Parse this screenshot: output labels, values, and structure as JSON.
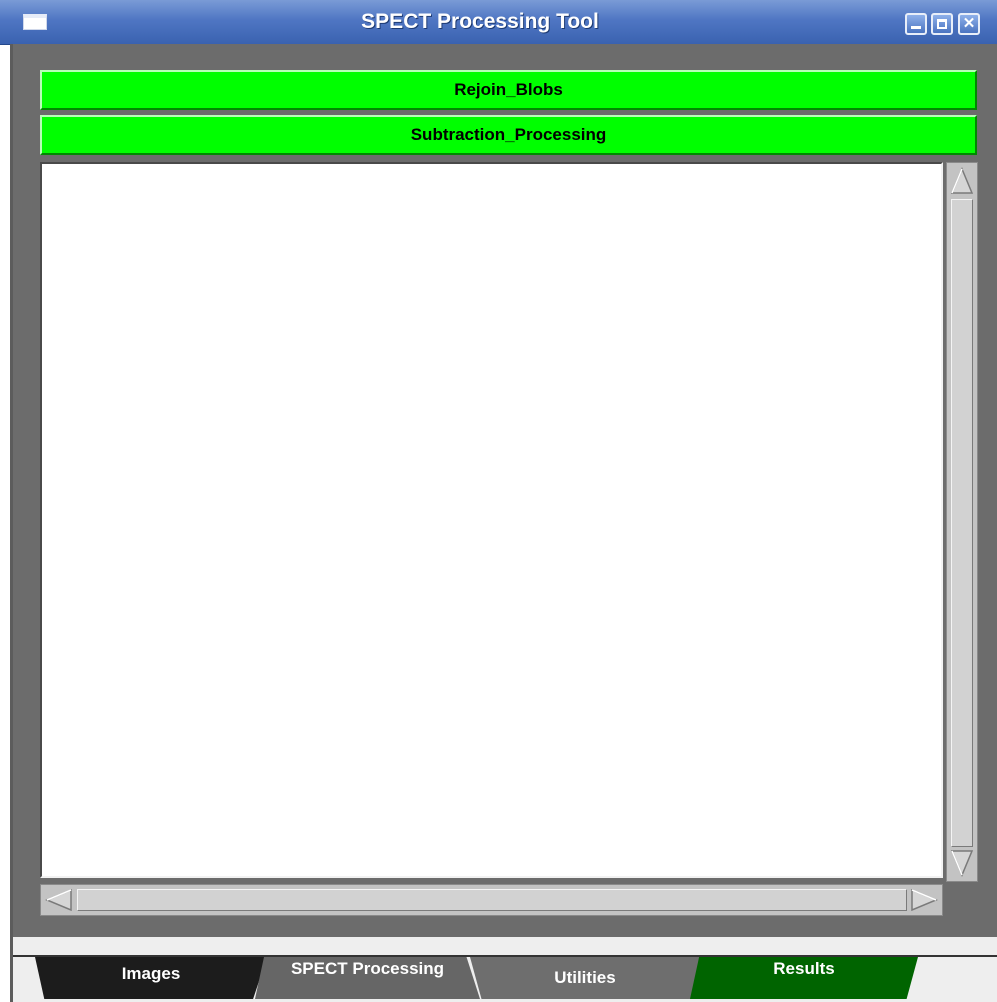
{
  "window": {
    "title": "SPECT Processing Tool"
  },
  "processing_buttons": [
    {
      "label": "Rejoin_Blobs"
    },
    {
      "label": "Subtraction_Processing"
    }
  ],
  "tabs": [
    {
      "label": "Images",
      "state": "inactive"
    },
    {
      "label": "SPECT Processing",
      "state": "selected"
    },
    {
      "label": "Utilities",
      "state": "inactive"
    },
    {
      "label": "Results",
      "state": "inactive"
    }
  ],
  "icons": {
    "window_menu": "window-menu-icon",
    "minimize": "minimize-icon",
    "maximize": "maximize-icon",
    "close": "close-icon"
  },
  "colors": {
    "titlebar": "#4f76c3",
    "button_green": "#00ff00",
    "panel_gray": "#6c6c6c",
    "tab_images": "#1c1c1c",
    "tab_spect": "#666666",
    "tab_utilities": "#6e6e6e",
    "tab_results": "#006400"
  }
}
